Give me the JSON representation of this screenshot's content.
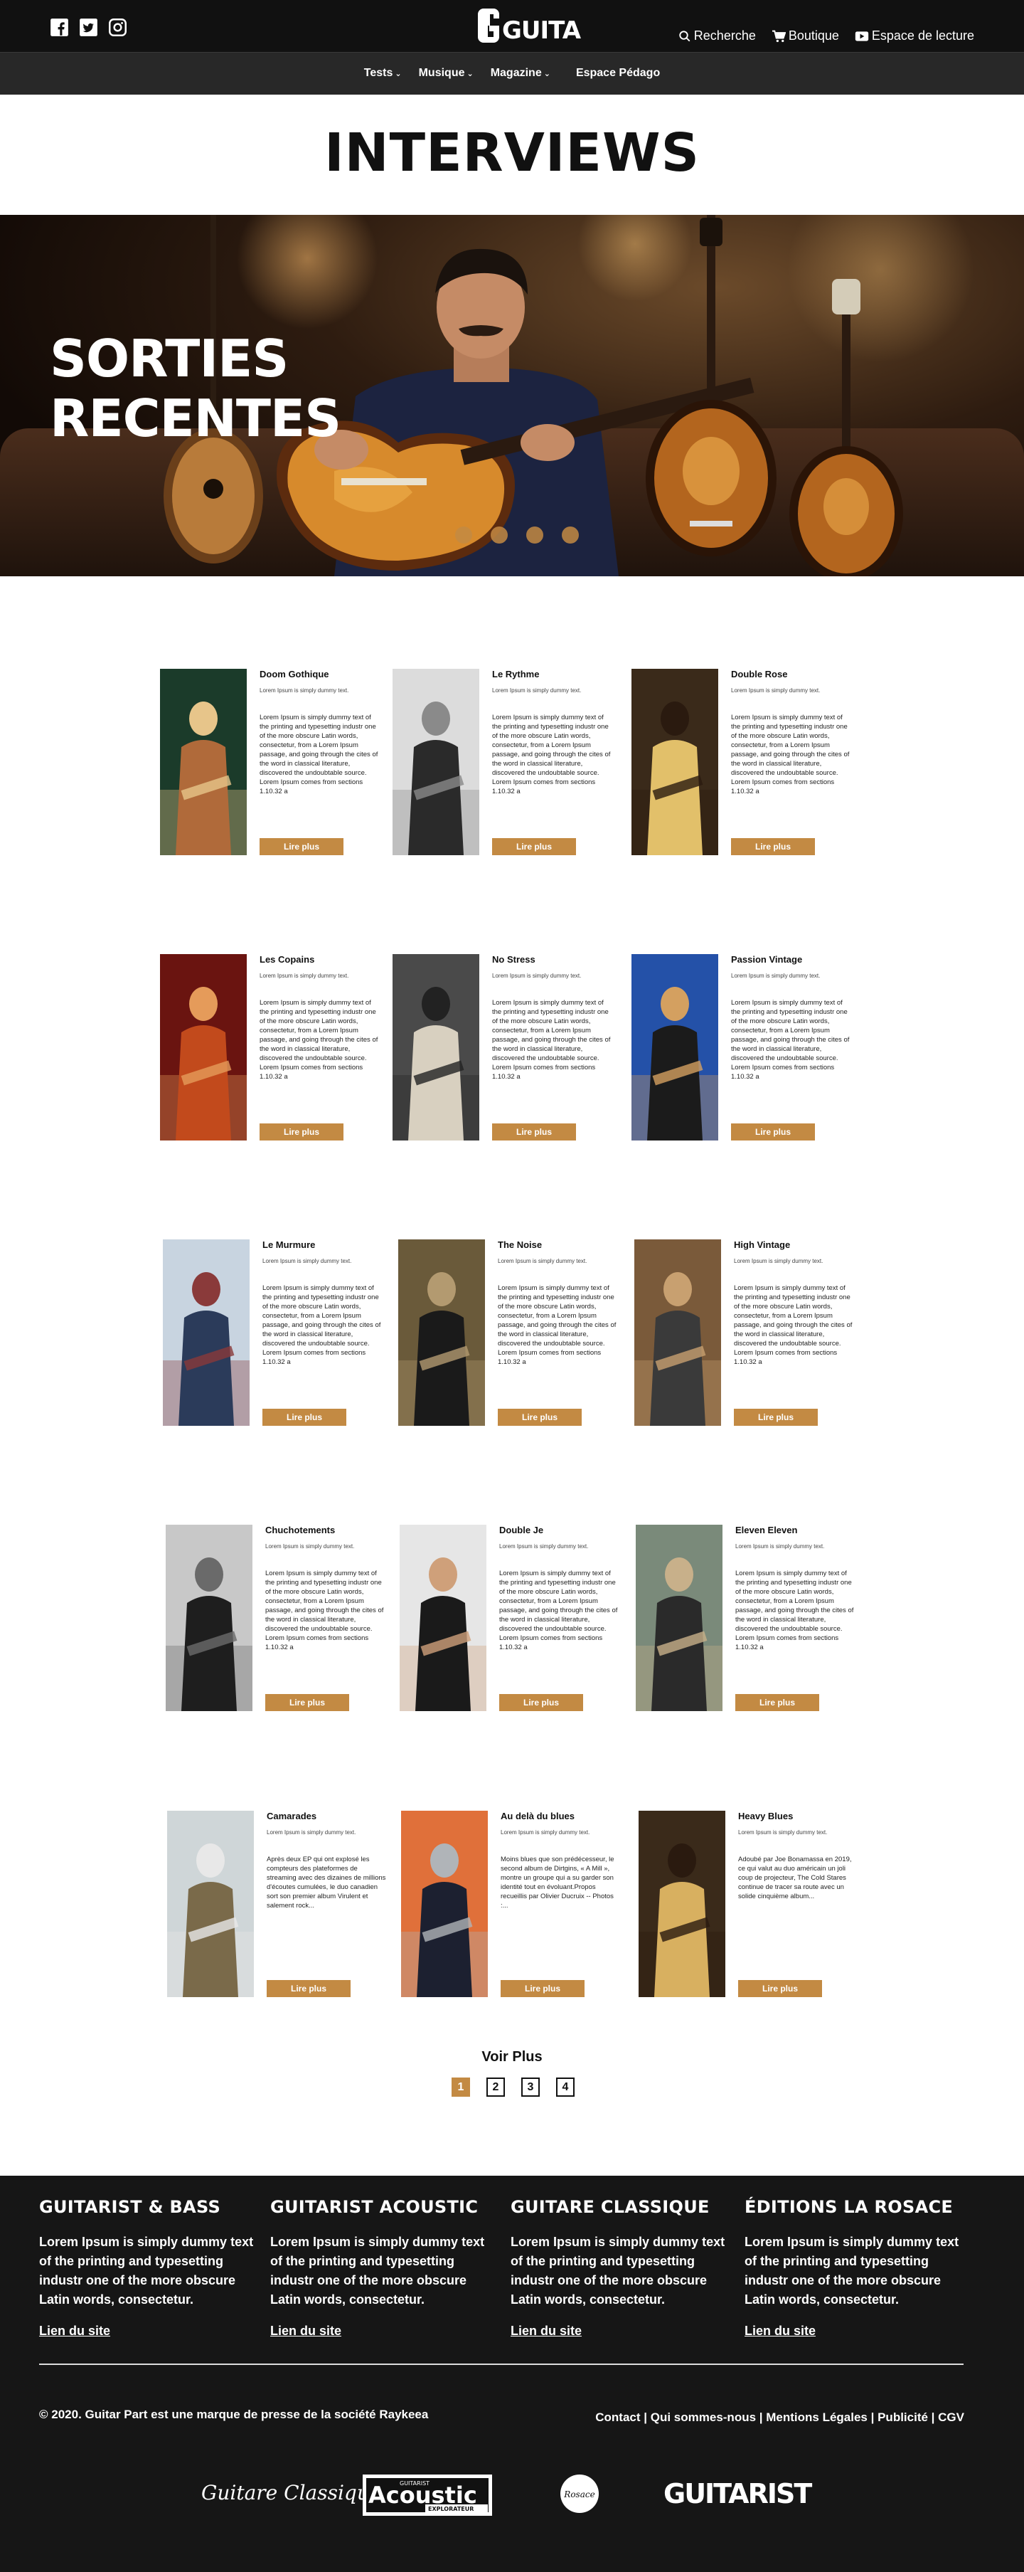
{
  "header": {
    "social": [
      "facebook-icon",
      "twitter-icon",
      "instagram-icon"
    ],
    "logo_text": "GUITAR PART",
    "search_label": "Recherche",
    "shop_label": "Boutique",
    "reading_label": "Espace de lecture"
  },
  "nav": {
    "items": [
      {
        "label": "Tests"
      },
      {
        "label": "Musique"
      },
      {
        "label": "Magazine"
      }
    ],
    "pedago": "Espace Pédago"
  },
  "page_title": "INTERVIEWS",
  "hero": {
    "line1": "SORTIES",
    "line2": "RECENTES",
    "slides": 4,
    "active_slide": 1
  },
  "cards": [
    {
      "title": "Doom Gothique",
      "subtitle": "Lorem Ipsum is simply dummy text.",
      "body": "Lorem Ipsum is simply dummy text of the printing and typesetting industr  one of the more obscure Latin words, consectetur, from a Lorem Ipsum passage, and going through the cites of the word in classical literature, discovered the undoubtable source. Lorem Ipsum comes from sections 1.10.32 a",
      "button": "Lire plus"
    },
    {
      "title": "Le Rythme",
      "subtitle": "Lorem Ipsum is simply dummy text.",
      "body": "Lorem Ipsum is simply dummy text of the printing and typesetting industr  one of the more obscure Latin words, consectetur, from a Lorem Ipsum passage, and going through the cites of the word in classical literature, discovered the undoubtable source. Lorem Ipsum comes from sections 1.10.32 a",
      "button": "Lire plus"
    },
    {
      "title": "Double Rose",
      "subtitle": "Lorem Ipsum is simply dummy text.",
      "body": "Lorem Ipsum is simply dummy text of the printing and typesetting industr  one of the more obscure Latin words, consectetur, from a Lorem Ipsum passage, and going through the cites of the word in classical literature, discovered the undoubtable source. Lorem Ipsum comes from sections 1.10.32 a",
      "button": "Lire plus"
    },
    {
      "title": "Les Copains",
      "subtitle": "Lorem Ipsum is simply dummy text.",
      "body": "Lorem Ipsum is simply dummy text of the printing and typesetting industr  one of the more obscure Latin words, consectetur, from a Lorem Ipsum passage, and going through the cites of the word in classical literature, discovered the undoubtable source. Lorem Ipsum comes from sections 1.10.32 a",
      "button": "Lire plus"
    },
    {
      "title": "No Stress",
      "subtitle": "Lorem Ipsum is simply dummy text.",
      "body": "Lorem Ipsum is simply dummy text of the printing and typesetting industr  one of the more obscure Latin words, consectetur, from a Lorem Ipsum passage, and going through the cites of the word in classical literature, discovered the undoubtable source. Lorem Ipsum comes from sections 1.10.32 a",
      "button": "Lire plus"
    },
    {
      "title": "Passion Vintage",
      "subtitle": "Lorem Ipsum is simply dummy text.",
      "body": "Lorem Ipsum is simply dummy text of the printing and typesetting industr  one of the more obscure Latin words, consectetur, from a Lorem Ipsum passage, and going through the cites of the word in classical literature, discovered the undoubtable source. Lorem Ipsum comes from sections 1.10.32 a",
      "button": "Lire plus"
    },
    {
      "title": "Le Murmure",
      "subtitle": "Lorem Ipsum is simply dummy text.",
      "body": "Lorem Ipsum is simply dummy text of the printing and typesetting industr  one of the more obscure Latin words, consectetur, from a Lorem Ipsum passage, and going through the cites of the word in classical literature, discovered the undoubtable source. Lorem Ipsum comes from sections 1.10.32 a",
      "button": "Lire plus"
    },
    {
      "title": "The Noise",
      "subtitle": "Lorem Ipsum is simply dummy text.",
      "body": "Lorem Ipsum is simply dummy text of the printing and typesetting industr  one of the more obscure Latin words, consectetur, from a Lorem Ipsum passage, and going through the cites of the word in classical literature, discovered the undoubtable source. Lorem Ipsum comes from sections 1.10.32 a",
      "button": "Lire plus"
    },
    {
      "title": "High Vintage",
      "subtitle": "Lorem Ipsum is simply dummy text.",
      "body": "Lorem Ipsum is simply dummy text of the printing and typesetting industr  one of the more obscure Latin words, consectetur, from a Lorem Ipsum passage, and going through the cites of the word in classical literature, discovered the undoubtable source. Lorem Ipsum comes from sections 1.10.32 a",
      "button": "Lire plus"
    },
    {
      "title": "Chuchotements",
      "subtitle": "Lorem Ipsum is simply dummy text.",
      "body": "Lorem Ipsum is simply dummy text of the printing and typesetting industr  one of the more obscure Latin words, consectetur, from a Lorem Ipsum passage, and going through the cites of the word in classical literature, discovered the undoubtable source. Lorem Ipsum comes from sections 1.10.32 a",
      "button": "Lire plus"
    },
    {
      "title": "Double Je",
      "subtitle": "Lorem Ipsum is simply dummy text.",
      "body": "Lorem Ipsum is simply dummy text of the printing and typesetting industr  one of the more obscure Latin words, consectetur, from a Lorem Ipsum passage, and going through the cites of the word in classical literature, discovered the undoubtable source. Lorem Ipsum comes from sections 1.10.32 a",
      "button": "Lire plus"
    },
    {
      "title": "Eleven Eleven",
      "subtitle": "Lorem Ipsum is simply dummy text.",
      "body": "Lorem Ipsum is simply dummy text of the printing and typesetting industr  one of the more obscure Latin words, consectetur, from a Lorem Ipsum passage, and going through the cites of the word in classical literature, discovered the undoubtable source. Lorem Ipsum comes from sections 1.10.32 a",
      "button": "Lire plus"
    },
    {
      "title": "Camarades",
      "subtitle": "Lorem Ipsum is simply dummy text.",
      "body": "Après deux EP qui ont explosé les compteurs des plateformes de streaming avec des dizaines de millions d'écoutes cumulées, le duo canadien sort son premier album  Virulent et salement rock...",
      "button": "Lire plus"
    },
    {
      "title": "Au delà du blues",
      "subtitle": "Lorem Ipsum is simply dummy text.",
      "body": "Moins blues que son prédécesseur, le second album de Dirtgins, « A Mill », montre un groupe qui a su garder son identité tout en évoluant.Propos recueillis par Olivier Ducruix -- Photos :...",
      "button": "Lire plus"
    },
    {
      "title": "Heavy Blues",
      "subtitle": "Lorem Ipsum is simply dummy text.",
      "body": "Adoubé par Joe Bonamassa en 2019, ce qui valut au duo américain un joli coup de projecteur, The Cold Stares continue de tracer sa route avec un solide cinquième album...",
      "button": "Lire plus"
    }
  ],
  "pagination": {
    "voir_plus": "Voir Plus",
    "pages": [
      "1",
      "2",
      "3",
      "4"
    ],
    "active": "1"
  },
  "footer": {
    "columns": [
      {
        "title": "GUITARIST & BASS",
        "text": "Lorem Ipsum is simply dummy text of the printing and typesetting industr one of the more obscure Latin words, consectetur.",
        "link": "Lien du site"
      },
      {
        "title": "GUITARIST ACOUSTIC",
        "text": "Lorem Ipsum is simply dummy text of the printing and typesetting industr one of the more obscure Latin words, consectetur.",
        "link": "Lien du site"
      },
      {
        "title": "GUITARE CLASSIQUE",
        "text": "Lorem Ipsum is simply dummy text of the printing and typesetting industr one of the more obscure Latin words, consectetur.",
        "link": "Lien du site"
      },
      {
        "title": "ÉDITIONS LA ROSACE",
        "text": "Lorem Ipsum is simply dummy text of the printing and typesetting industr one of the more obscure Latin words, consectetur.",
        "link": "Lien du site"
      }
    ],
    "copyright": "© 2020. Guitar Part est une marque de presse de la société Raykeea",
    "links": [
      "Contact",
      "Qui sommes-nous",
      "Mentions Légales",
      "Publicité",
      "CGV"
    ],
    "brands": {
      "b1": "Guitare Classique",
      "b2a": "GUITARIST",
      "b2b": "Acoustic",
      "b2c": "EXPLORATEUR",
      "b3": "Rosace",
      "b4": "GUITARIST"
    }
  },
  "colors": {
    "accent": "#c38a43",
    "dark": "#111111",
    "nav": "#282828",
    "footer": "#161616"
  }
}
